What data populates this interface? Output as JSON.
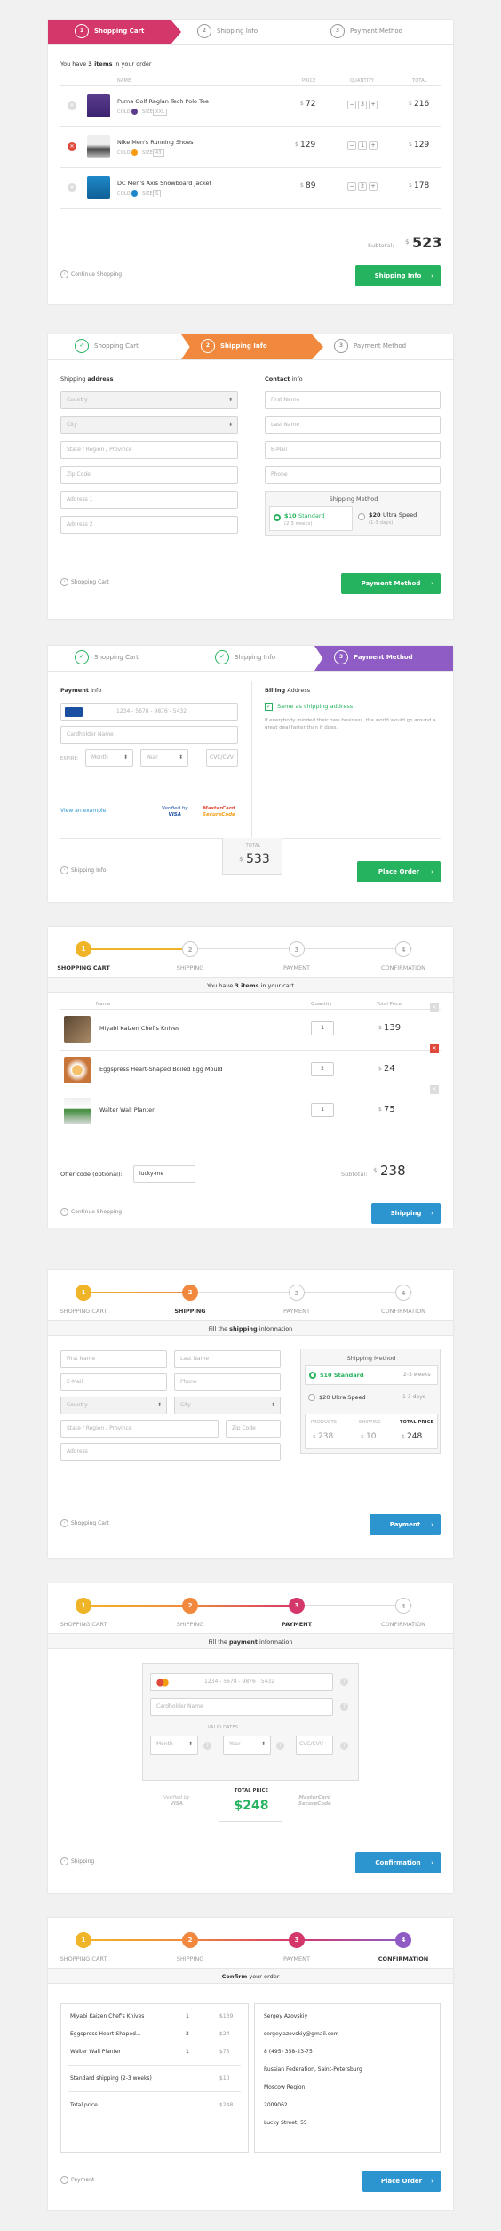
{
  "s1": {
    "tabs": [
      {
        "n": "1",
        "label": "Shopping Cart"
      },
      {
        "n": "2",
        "label": "Shipping Info"
      },
      {
        "n": "3",
        "label": "Payment Method"
      }
    ],
    "intro_pre": "You have ",
    "intro_bold": "3 items",
    "intro_post": " in your order",
    "headers": {
      "name": "NAME",
      "price": "PRICE",
      "quantity": "QUANTITY",
      "total": "TOTAL"
    },
    "items": [
      {
        "name": "Puma Golf Raglan Tech Polo Tee",
        "color_label": "COLOR:",
        "size_label": "SIZE:",
        "size": "XXL",
        "price": "72",
        "qty": "3",
        "total": "216"
      },
      {
        "name": "Nike Men's Running Shoes",
        "color_label": "COLOR:",
        "size_label": "SIZE:",
        "size": "43",
        "price": "129",
        "qty": "1",
        "total": "129"
      },
      {
        "name": "DC Men's Axis Snowboard Jacket",
        "color_label": "COLOR:",
        "size_label": "SIZE:",
        "size": "S",
        "price": "89",
        "qty": "2",
        "total": "178"
      }
    ],
    "subtotal_label": "Subtotal:",
    "subtotal": "523",
    "currency": "$",
    "continue": "Continue Shopping",
    "next": "Shipping Info"
  },
  "s2": {
    "tabs": [
      {
        "n": "✓",
        "label": "Shopping Cart"
      },
      {
        "n": "2",
        "label": "Shipping Info"
      },
      {
        "n": "3",
        "label": "Payment Method"
      }
    ],
    "ship_title": "Shipping",
    "ship_title_b": "address",
    "contact_title": "Contact",
    "contact_title_b": "info",
    "fields_left": [
      "Country",
      "City",
      "State / Region / Province",
      "Zip Code",
      "Address 1",
      "Address 2"
    ],
    "fields_right": [
      "First Name",
      "Last Name",
      "E-Mail",
      "Phone"
    ],
    "method_title": "Shipping Method",
    "opt1_price": "$10",
    "opt1_name": "Standard",
    "opt1_days": "(2-3 weeks)",
    "opt2_price": "$20",
    "opt2_name": "Ultra Speed",
    "opt2_days": "(1-3 days)",
    "back": "Shopping Cart",
    "next": "Payment Method"
  },
  "s3": {
    "tabs": [
      {
        "n": "✓",
        "label": "Shopping Cart"
      },
      {
        "n": "✓",
        "label": "Shipping Info"
      },
      {
        "n": "3",
        "label": "Payment Method"
      }
    ],
    "pay_title": "Payment",
    "pay_title_b": "Info",
    "bill_title": "Billing",
    "bill_title_b": "Address",
    "card_ph": "1234 - 5678 - 9876 - 5432",
    "holder_ph": "Cardholder Name",
    "expire": "EXPIRE:",
    "month": "Month",
    "year": "Year",
    "cvc": "CVC/CVV",
    "same": "Same as shipping address",
    "note": "If everybody minded their own business, the world would go around a great deal faster than it does.",
    "example": "View an example",
    "verified": "Verified by",
    "visa": "VISA",
    "mc": "MasterCard",
    "mc2": "SecureCode",
    "total_label": "TOTAL",
    "total": "533",
    "back": "Shipping Info",
    "next": "Place Order"
  },
  "steps": [
    "SHOPPING CART",
    "SHIPPING",
    "PAYMENT",
    "CONFIRMATION"
  ],
  "s4": {
    "intro_pre": "You have ",
    "intro_bold": "3 items",
    "intro_post": " in your cart",
    "headers": {
      "name": "Name",
      "quantity": "Quantity",
      "total": "Total Price"
    },
    "items": [
      {
        "name": "Miyabi Kaizen Chef's Knives",
        "qty": "1",
        "total": "139"
      },
      {
        "name": "Eggspress Heart-Shaped Boiled Egg Mould",
        "qty": "2",
        "total": "24"
      },
      {
        "name": "Walter Wall Planter",
        "qty": "1",
        "total": "75"
      }
    ],
    "offer_label": "Offer code (optional):",
    "offer": "lucky-me",
    "subtotal_label": "Subtotal:",
    "subtotal": "238",
    "continue": "Continue Shopping",
    "next": "Shipping"
  },
  "s5": {
    "fill_pre": "Fill the ",
    "fill_bold": "shipping",
    "fill_post": " information",
    "fields": [
      "First Name",
      "Last Name",
      "E-Mail",
      "Phone",
      "Country",
      "City",
      "State / Region / Province",
      "Zip Code",
      "Address"
    ],
    "method_title": "Shipping Method",
    "opt1": "$10 Standard",
    "opt1_days": "2-3 weeks",
    "opt2": "$20 Ultra Speed",
    "opt2_days": "1-3 days",
    "products_label": "PRODUCTS",
    "shipping_label": "SHIPPING",
    "total_label": "TOTAL PRICE",
    "products": "238",
    "shipping": "10",
    "total": "248",
    "back": "Shopping Cart",
    "next": "Payment"
  },
  "s6": {
    "fill_pre": "Fill the ",
    "fill_bold": "payment",
    "fill_post": " information",
    "card_ph": "1234 - 5678 - 9876 - 5432",
    "holder_ph": "Cardholder Name",
    "valid": "VALID DATES",
    "month": "Month",
    "year": "Year",
    "cvc": "CVC/CVV",
    "total_label": "TOTAL PRICE",
    "total": "$248",
    "verified": "Verified by",
    "visa": "VISA",
    "mc": "MasterCard",
    "mc2": "SecureCode",
    "back": "Shipping",
    "next": "Confirmation"
  },
  "s7": {
    "title_b": "Confirm",
    "title_post": " your order",
    "lines": [
      {
        "name": "Miyabi Kaizen Chef's Knives",
        "qty": "1",
        "price": "$139"
      },
      {
        "name": "Eggspress Heart-Shaped...",
        "qty": "2",
        "price": "$24"
      },
      {
        "name": "Walter Wall Planter",
        "qty": "1",
        "price": "$75"
      }
    ],
    "ship_line": "Standard shipping (2-3 weeks)",
    "ship_price": "$10",
    "total_label": "Total price",
    "total": "$248",
    "contact": [
      "Sergey Azovskiy",
      "sergey.azovskiy@gmail.com",
      "8 (495) 358-23-75",
      "Russian Federation, Saint-Petersburg",
      "Moscow Region",
      "2009062",
      "Lucky Street, 55"
    ],
    "back": "Payment",
    "next": "Place Order"
  },
  "colors": {
    "pink": "#d4386a",
    "orange": "#f0883e",
    "purple": "#8e5cc4",
    "yellow": "#f0b429",
    "green": "#25b35f",
    "blue": "#2c95d0"
  }
}
